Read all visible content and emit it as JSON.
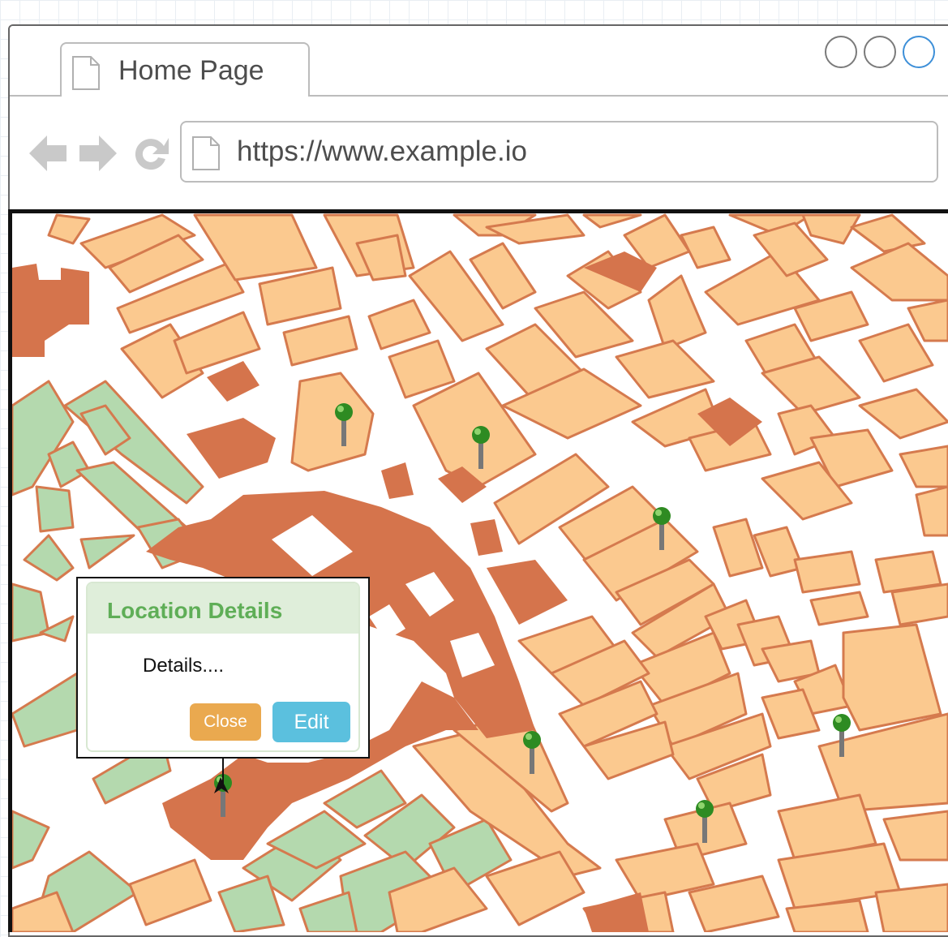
{
  "browser": {
    "tab": {
      "title": "Home Page",
      "icon": "document-icon"
    },
    "window_controls": [
      "minimize",
      "maximize",
      "close"
    ],
    "nav": {
      "back_icon": "back-arrow-icon",
      "forward_icon": "forward-arrow-icon",
      "reload_icon": "reload-icon"
    },
    "address_bar": {
      "url": "https://www.example.io",
      "icon": "document-icon"
    }
  },
  "map": {
    "colors": {
      "building": "#fbc98f",
      "building_stroke": "#d57a4e",
      "landmark": "#d5744c",
      "park": "#b4d9ae",
      "park_stroke": "#d57a4e",
      "road": "#ffffff",
      "pin": "#2e8b22"
    },
    "marker_count": 7
  },
  "popup": {
    "title": "Location Details",
    "body": "Details....",
    "close_label": "Close",
    "edit_label": "Edit",
    "colors": {
      "header_bg": "#dfeeda",
      "title": "#5fae57",
      "close_bg": "#eaa94f",
      "edit_bg": "#5bc0de"
    }
  }
}
